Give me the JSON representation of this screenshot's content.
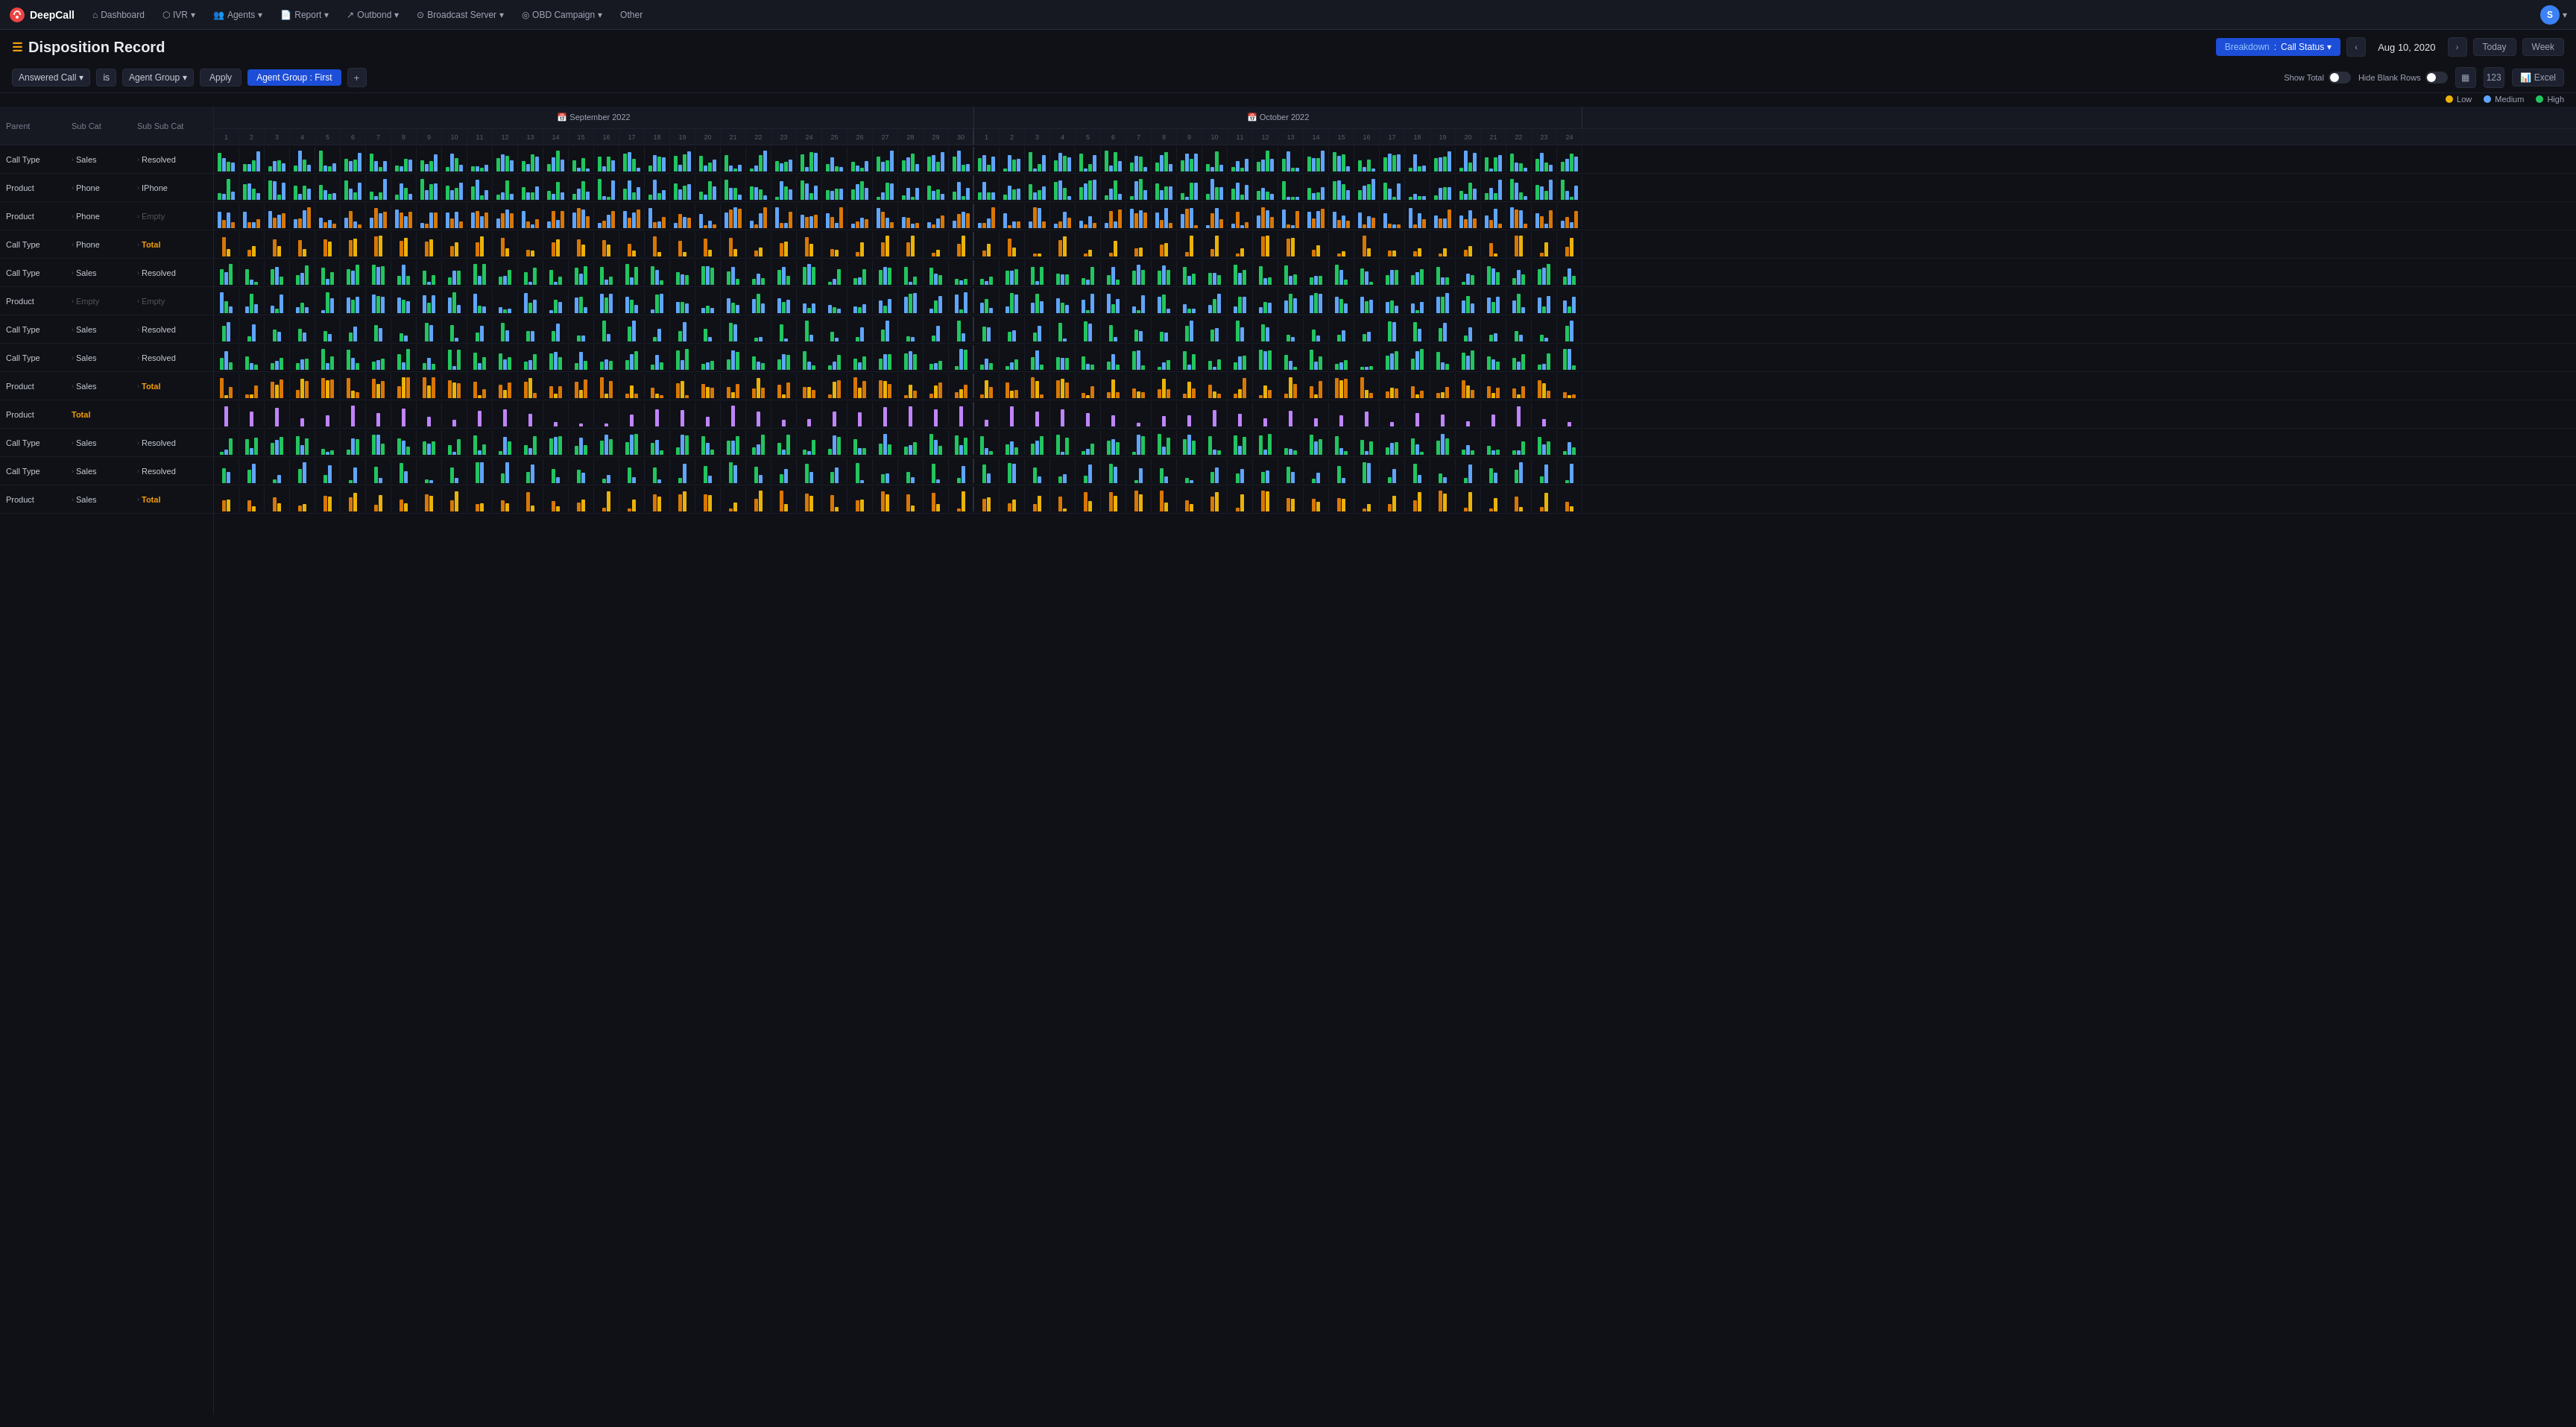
{
  "app": {
    "name": "DeepCall"
  },
  "navbar": {
    "items": [
      {
        "label": "Dashboard",
        "icon": "home"
      },
      {
        "label": "IVR",
        "icon": "ivr",
        "hasDropdown": true
      },
      {
        "label": "Agents",
        "icon": "agents",
        "hasDropdown": true
      },
      {
        "label": "Report",
        "icon": "report",
        "hasDropdown": true
      },
      {
        "label": "Outbond",
        "icon": "outbond",
        "hasDropdown": true
      },
      {
        "label": "Broadcast Server",
        "icon": "broadcast",
        "hasDropdown": true
      },
      {
        "label": "OBD Campaign",
        "icon": "obd",
        "hasDropdown": true
      },
      {
        "label": "Other",
        "icon": "other"
      }
    ],
    "avatar": "S"
  },
  "page": {
    "title": "Disposition Record",
    "breakdown_label": "Breakdown",
    "breakdown_value": "Call Status",
    "date": "Aug 10, 2020",
    "today_label": "Today",
    "week_label": "Week"
  },
  "filters": {
    "field1": "Answered Call",
    "field2": "is",
    "field3": "Agent Group",
    "apply_label": "Apply",
    "tag_label": "Agent Group : First",
    "plus_label": "+",
    "show_total_label": "Show Total",
    "hide_blank_label": "Hide Blank Rows",
    "excel_label": "Excel"
  },
  "legend": {
    "low_label": "Low",
    "medium_label": "Medium",
    "high_label": "High"
  },
  "table": {
    "col_parent": "Parent",
    "col_subcat": "Sub Cat",
    "col_subsubcat": "Sub Sub Cat",
    "months": [
      {
        "name": "September 2022",
        "days": 30
      },
      {
        "name": "October 2022",
        "days": 24
      }
    ],
    "rows": [
      {
        "parent": "Call Type",
        "subcat": "Sales",
        "subsubcat": "Resolved",
        "color": "green"
      },
      {
        "parent": "Product",
        "subcat": "Phone",
        "subsubcat": "IPhone",
        "color": "green"
      },
      {
        "parent": "Product",
        "subcat": "Phone",
        "subsubcat": "Empty",
        "color": "blue",
        "empty": true
      },
      {
        "parent": "Call Type",
        "subcat": "Phone",
        "subsubcat": "Total",
        "color": "orange",
        "isTotal": true
      },
      {
        "parent": "Call Type",
        "subcat": "Sales",
        "subsubcat": "Resolved",
        "color": "green"
      },
      {
        "parent": "Product",
        "subcat": "Empty",
        "subsubcat": "Empty",
        "color": "blue",
        "empty": true
      },
      {
        "parent": "Call Type",
        "subcat": "Sales",
        "subsubcat": "Resolved",
        "color": "green"
      },
      {
        "parent": "Call Type",
        "subcat": "Sales",
        "subsubcat": "Resolved",
        "color": "green"
      },
      {
        "parent": "Product",
        "subcat": "Sales",
        "subsubcat": "Total",
        "color": "orange",
        "isTotal": true
      },
      {
        "parent": "Product",
        "subcat": "Total",
        "subsubcat": "",
        "color": "purple",
        "isTotal": true
      },
      {
        "parent": "Call Type",
        "subcat": "Sales",
        "subsubcat": "Resolved",
        "color": "green"
      },
      {
        "parent": "Call Type",
        "subcat": "Sales",
        "subsubcat": "Resolved",
        "color": "green"
      },
      {
        "parent": "Product",
        "subcat": "Sales",
        "subsubcat": "Total",
        "color": "orange",
        "isTotal": true
      }
    ]
  },
  "colors": {
    "accent": "#1d4ed8",
    "brand_orange": "#f59e0b",
    "success": "#22c55e",
    "info": "#60a5fa",
    "warning": "#d97706",
    "purple": "#c084fc"
  }
}
